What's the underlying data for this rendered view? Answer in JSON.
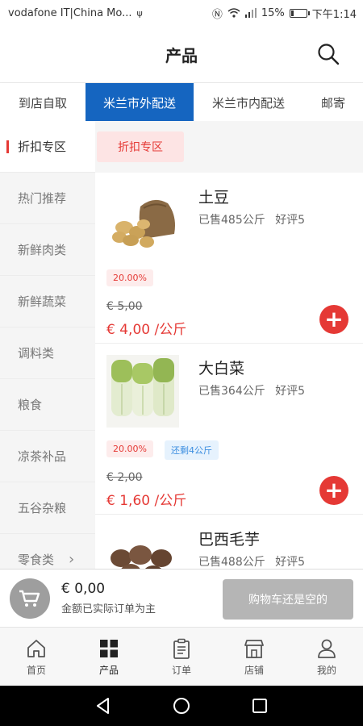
{
  "status_bar": {
    "carrier": "vodafone IT|China Mo...",
    "sim_glyph": "ψ",
    "signal_glyph": "Ⓝ",
    "battery": "15%",
    "time": "下午1:14"
  },
  "header": {
    "title": "产品"
  },
  "tabs": [
    {
      "label": "到店自取",
      "active": false
    },
    {
      "label": "米兰市外配送",
      "active": true
    },
    {
      "label": "米兰市内配送",
      "active": false
    },
    {
      "label": "邮寄",
      "active": false
    }
  ],
  "sidebar": {
    "items": [
      {
        "label": "折扣专区",
        "active": true
      },
      {
        "label": "热门推荐"
      },
      {
        "label": "新鲜肉类"
      },
      {
        "label": "新鲜蔬菜"
      },
      {
        "label": "调料类"
      },
      {
        "label": "粮食"
      },
      {
        "label": "凉茶补品"
      },
      {
        "label": "五谷杂粮"
      },
      {
        "label": "零食类",
        "chevron": "›"
      }
    ]
  },
  "main": {
    "category_chip": "折扣专区",
    "products": [
      {
        "name": "土豆",
        "sold": "已售485公斤",
        "rating": "好评5",
        "discount": "20.00%",
        "stock": "",
        "old_price": "€ 5,00",
        "new_price": "€ 4,00 /公斤",
        "image": "potatoes-sack"
      },
      {
        "name": "大白菜",
        "sold": "已售364公斤",
        "rating": "好评5",
        "discount": "20.00%",
        "stock": "还剩4公斤",
        "old_price": "€ 2,00",
        "new_price": "€ 1,60 /公斤",
        "image": "napa-cabbage"
      },
      {
        "name": "巴西毛芋",
        "sold": "已售488公斤",
        "rating": "好评5",
        "discount": "",
        "stock": "",
        "old_price": "",
        "new_price": "",
        "image": "taro"
      }
    ]
  },
  "cart": {
    "total": "€ 0,00",
    "note": "金额已实际订单为主",
    "checkout_label": "购物车还是空的"
  },
  "bottom_nav": [
    {
      "label": "首页",
      "icon": "home-icon"
    },
    {
      "label": "产品",
      "icon": "grid-icon",
      "active": true
    },
    {
      "label": "订单",
      "icon": "clipboard-icon"
    },
    {
      "label": "店铺",
      "icon": "store-icon"
    },
    {
      "label": "我的",
      "icon": "user-icon"
    }
  ],
  "colors": {
    "accent_blue": "#1565c0",
    "price_red": "#e53935",
    "sidebar_bg": "#f5f5f5"
  }
}
